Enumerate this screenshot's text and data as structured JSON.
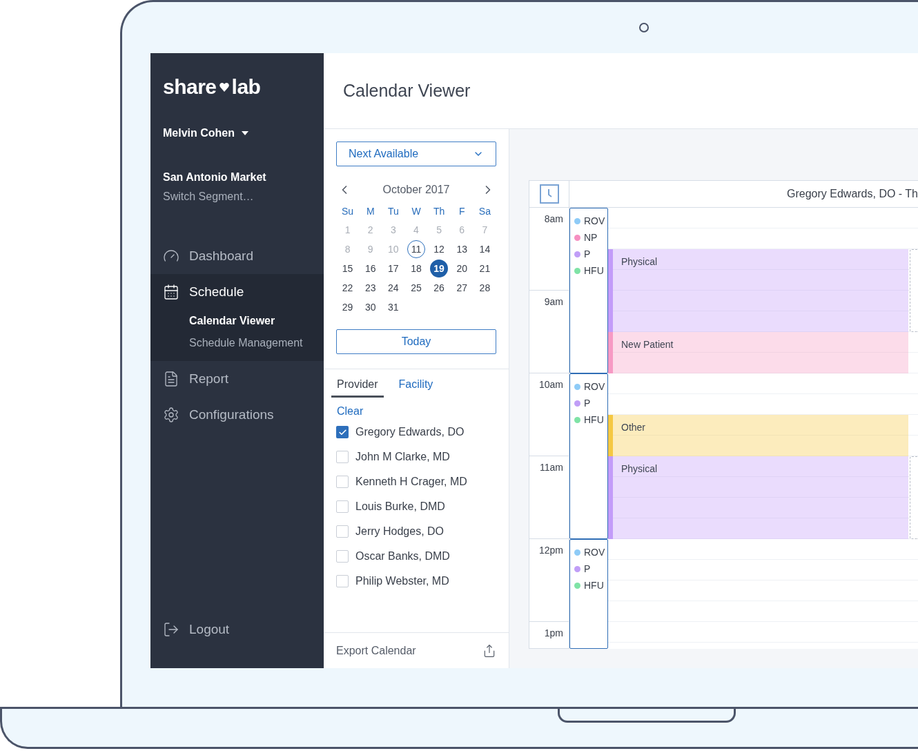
{
  "sidebar": {
    "logo_words": [
      "share",
      "lab"
    ],
    "user": {
      "name": "Melvin Cohen"
    },
    "market": {
      "name": "San Antonio Market",
      "action": "Switch Segment…"
    },
    "nav": [
      {
        "label": "Dashboard",
        "kind": "gauge",
        "selected": false
      },
      {
        "label": "Schedule",
        "kind": "calendar",
        "selected": true,
        "children": [
          {
            "label": "Calendar Viewer",
            "selected": true
          },
          {
            "label": "Schedule Management",
            "selected": false
          }
        ]
      },
      {
        "label": "Report",
        "kind": "report",
        "selected": false
      },
      {
        "label": "Configurations",
        "kind": "settings",
        "selected": false
      }
    ],
    "logout": {
      "label": "Logout"
    }
  },
  "header": {
    "title": "Calendar Viewer"
  },
  "filters": {
    "mode_select": {
      "value": "Next Available"
    },
    "calendar": {
      "month": "October 2017",
      "weekdays": [
        "Su",
        "M",
        "Tu",
        "W",
        "Th",
        "F",
        "Sa"
      ],
      "days": [
        {
          "label": "1",
          "disabled": true,
          "today": false,
          "selected": false
        },
        {
          "label": "2",
          "disabled": true,
          "today": false,
          "selected": false
        },
        {
          "label": "3",
          "disabled": true,
          "today": false,
          "selected": false
        },
        {
          "label": "4",
          "disabled": true,
          "today": false,
          "selected": false
        },
        {
          "label": "5",
          "disabled": true,
          "today": false,
          "selected": false
        },
        {
          "label": "6",
          "disabled": true,
          "today": false,
          "selected": false
        },
        {
          "label": "7",
          "disabled": true,
          "today": false,
          "selected": false
        },
        {
          "label": "8",
          "disabled": true,
          "today": false,
          "selected": false
        },
        {
          "label": "9",
          "disabled": true,
          "today": false,
          "selected": false
        },
        {
          "label": "10",
          "disabled": true,
          "today": false,
          "selected": false
        },
        {
          "label": "11",
          "disabled": false,
          "today": true,
          "selected": false
        },
        {
          "label": "12",
          "disabled": false,
          "today": false,
          "selected": false
        },
        {
          "label": "13",
          "disabled": false,
          "today": false,
          "selected": false
        },
        {
          "label": "14",
          "disabled": false,
          "today": false,
          "selected": false
        },
        {
          "label": "15",
          "disabled": false,
          "today": false,
          "selected": false
        },
        {
          "label": "16",
          "disabled": false,
          "today": false,
          "selected": false
        },
        {
          "label": "17",
          "disabled": false,
          "today": false,
          "selected": false
        },
        {
          "label": "18",
          "disabled": false,
          "today": false,
          "selected": false
        },
        {
          "label": "19",
          "disabled": false,
          "today": false,
          "selected": true
        },
        {
          "label": "20",
          "disabled": false,
          "today": false,
          "selected": false
        },
        {
          "label": "21",
          "disabled": false,
          "today": false,
          "selected": false
        },
        {
          "label": "22",
          "disabled": false,
          "today": false,
          "selected": false
        },
        {
          "label": "23",
          "disabled": false,
          "today": false,
          "selected": false
        },
        {
          "label": "24",
          "disabled": false,
          "today": false,
          "selected": false
        },
        {
          "label": "25",
          "disabled": false,
          "today": false,
          "selected": false
        },
        {
          "label": "26",
          "disabled": false,
          "today": false,
          "selected": false
        },
        {
          "label": "27",
          "disabled": false,
          "today": false,
          "selected": false
        },
        {
          "label": "28",
          "disabled": false,
          "today": false,
          "selected": false
        },
        {
          "label": "29",
          "disabled": false,
          "today": false,
          "selected": false
        },
        {
          "label": "30",
          "disabled": false,
          "today": false,
          "selected": false
        },
        {
          "label": "31",
          "disabled": false,
          "today": false,
          "selected": false
        }
      ]
    },
    "today_button": "Today",
    "tabs": [
      {
        "label": "Provider",
        "selected": true
      },
      {
        "label": "Facility",
        "selected": false
      }
    ],
    "clear": "Clear",
    "providers": [
      {
        "name": "Gregory Edwards, DO",
        "checked": true
      },
      {
        "name": "John M Clarke, MD",
        "checked": false
      },
      {
        "name": "Kenneth H Crager, MD",
        "checked": false
      },
      {
        "name": "Louis Burke, DMD",
        "checked": false
      },
      {
        "name": "Jerry Hodges, DO",
        "checked": false
      },
      {
        "name": "Oscar Banks, DMD",
        "checked": false
      },
      {
        "name": "Philip Webster, MD",
        "checked": false
      }
    ],
    "export": {
      "label": "Export Calendar"
    }
  },
  "schedule": {
    "title": "Gregory Edwards, DO - Th",
    "hours": [
      "8am",
      "9am",
      "10am",
      "11am",
      "12pm",
      "1pm"
    ],
    "legend_groups": [
      {
        "items": [
          {
            "label": "ROV",
            "color": "#8ecbf7"
          },
          {
            "label": "NP",
            "color": "#f68fc1"
          },
          {
            "label": "P",
            "color": "#c09ef7"
          },
          {
            "label": "HFU",
            "color": "#7fe3a6"
          }
        ]
      },
      {
        "items": [
          {
            "label": "ROV",
            "color": "#8ecbf7"
          },
          {
            "label": "P",
            "color": "#c09ef7"
          },
          {
            "label": "HFU",
            "color": "#7fe3a6"
          }
        ]
      },
      {
        "items": [
          {
            "label": "ROV",
            "color": "#8ecbf7"
          },
          {
            "label": "P",
            "color": "#c09ef7"
          },
          {
            "label": "HFU",
            "color": "#7fe3a6"
          }
        ]
      }
    ],
    "blocks": [
      {
        "kind": "free_half"
      },
      {
        "kind": "event_hour",
        "label": "Physical",
        "color": "#c39cf9",
        "overlap": true
      },
      {
        "kind": "event_half",
        "label": "New Patient",
        "color": "#f79ac4",
        "overlap": false
      },
      {
        "kind": "free_half"
      },
      {
        "kind": "event_half",
        "label": "Other",
        "color": "#f5c842",
        "overlap": false
      },
      {
        "kind": "event_hour",
        "label": "Physical",
        "color": "#c39cf9",
        "overlap": true
      },
      {
        "kind": "free_rest"
      }
    ]
  }
}
